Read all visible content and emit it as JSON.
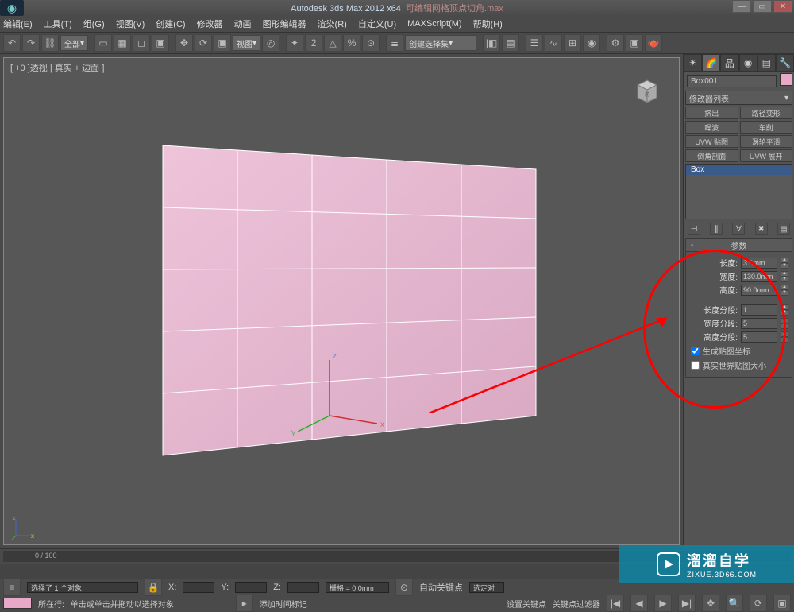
{
  "app": {
    "name": "Autodesk 3ds Max 2012 x64",
    "filename": "可编辑网格顶点切角.max"
  },
  "menu": [
    "编辑(E)",
    "工具(T)",
    "组(G)",
    "视图(V)",
    "创建(C)",
    "修改器",
    "动画",
    "图形编辑器",
    "渲染(R)",
    "自定义(U)",
    "MAXScript(M)",
    "帮助(H)"
  ],
  "toolbar": {
    "all_dd": "全部",
    "view_dd": "视图",
    "selmode_dd": "创建选择集"
  },
  "viewport": {
    "label": "[ +0 ]透视 | 真实 + 边面 ]"
  },
  "object": {
    "name": "Box001",
    "color": "#e8a8c8"
  },
  "modifier_dd": "修改器列表",
  "modbuttons": [
    [
      "挤出",
      "路径变形"
    ],
    [
      "噪波",
      "车削"
    ],
    [
      "UVW 贴图",
      "涡轮平滑"
    ],
    [
      "倒角剖面",
      "UVW 展开"
    ]
  ],
  "stack": {
    "selected": "Box"
  },
  "rollout": {
    "title": "参数",
    "length_lbl": "长度:",
    "length": "3.0mm",
    "width_lbl": "宽度:",
    "width": "130.0mm",
    "height_lbl": "高度:",
    "height": "90.0mm",
    "lseg_lbl": "长度分段:",
    "lseg": "1",
    "wseg_lbl": "宽度分段:",
    "wseg": "5",
    "hseg_lbl": "高度分段:",
    "hseg": "5",
    "gen_map": "生成贴图坐标",
    "real_world": "真实世界贴图大小"
  },
  "timeline": {
    "range": "0 / 100"
  },
  "status": {
    "sel": "选择了 1 个对象",
    "hint": "单击或单击并拖动以选择对象",
    "x": "X:",
    "y": "Y:",
    "z": "Z:",
    "grid": "栅格 = 0.0mm",
    "addtime": "添加时间标记",
    "autokey": "自动关键点",
    "selset": "选定对",
    "setkey": "设置关键点",
    "keyfilter": "关键点过滤器",
    "current": "所在行:"
  },
  "watermark": {
    "brand": "溜溜自学",
    "url": "ZIXUE.3D66.COM"
  }
}
